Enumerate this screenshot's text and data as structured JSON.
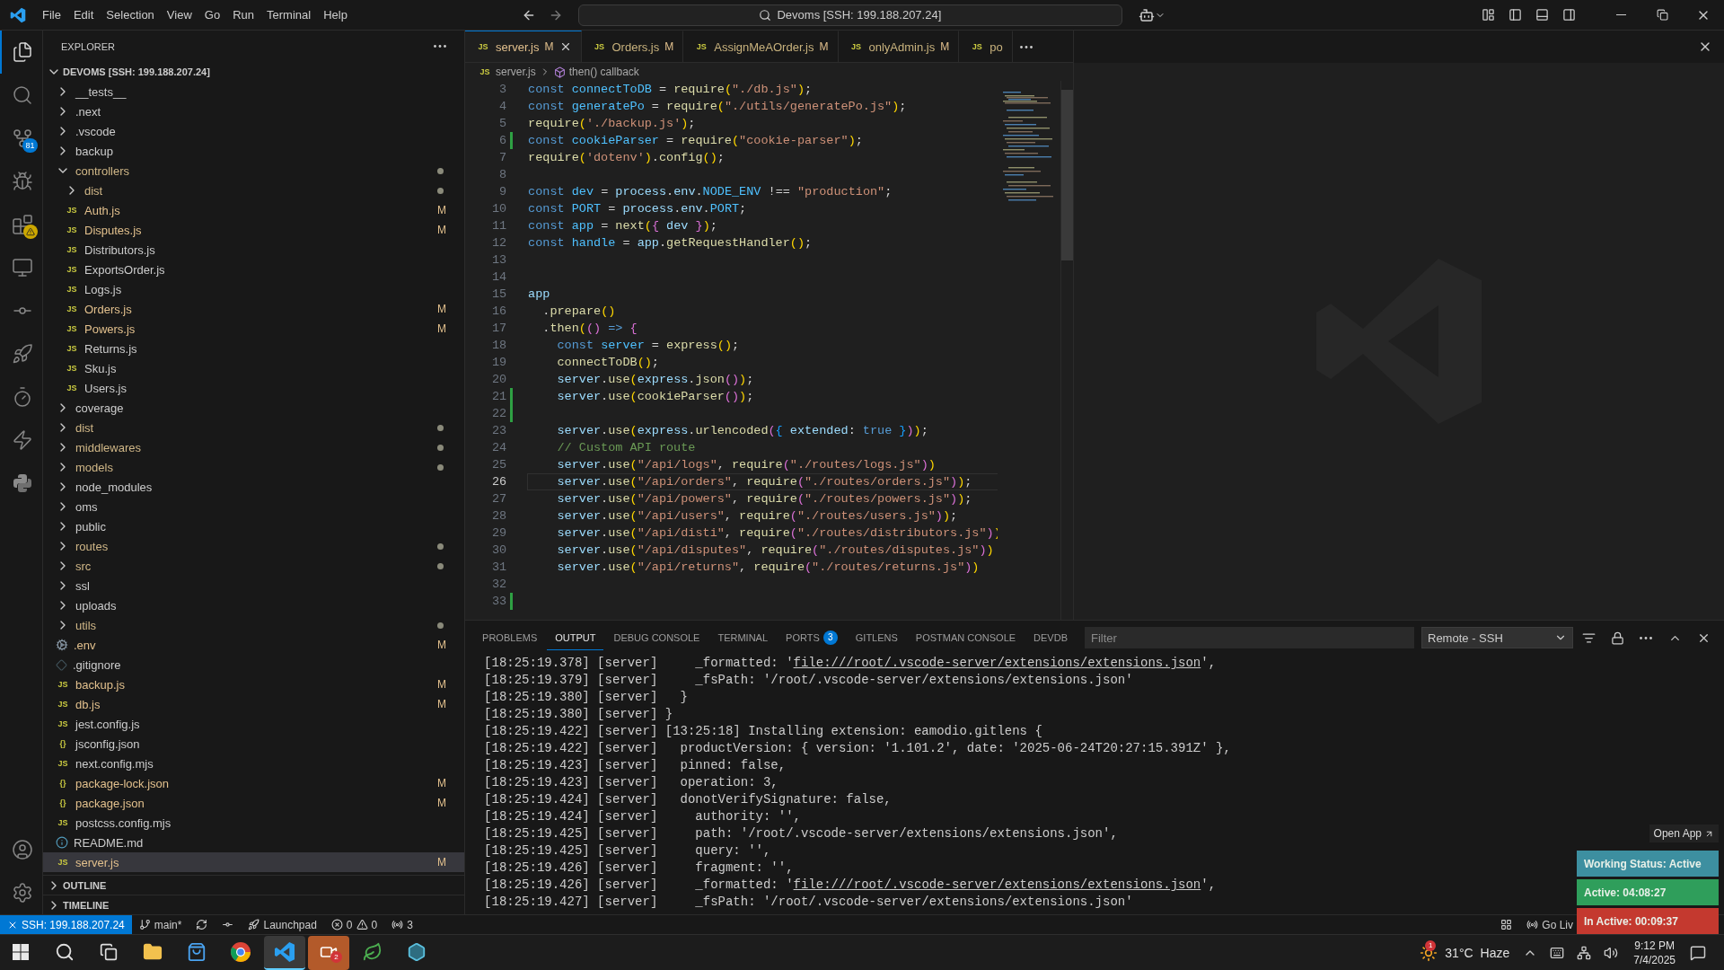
{
  "titlebar": {
    "menus": [
      "File",
      "Edit",
      "Selection",
      "View",
      "Go",
      "Run",
      "Terminal",
      "Help"
    ],
    "command_center": "Devoms [SSH: 199.188.207.24]"
  },
  "activity": [
    {
      "kind": "explorer",
      "selected": true,
      "warning": false
    },
    {
      "kind": "search",
      "selected": false,
      "warning": false
    },
    {
      "kind": "scm",
      "selected": false,
      "warning": false,
      "badge": "81"
    },
    {
      "kind": "debug",
      "selected": false,
      "warning": false
    },
    {
      "kind": "extensions",
      "selected": false,
      "warning": true
    },
    {
      "kind": "remote",
      "selected": false,
      "warning": false
    },
    {
      "kind": "gitlens",
      "selected": false,
      "warning": false
    },
    {
      "kind": "deploy",
      "selected": false,
      "warning": false
    },
    {
      "kind": "devdb",
      "selected": false,
      "warning": false
    },
    {
      "kind": "bolt",
      "selected": false,
      "warning": false
    },
    {
      "kind": "python",
      "selected": false,
      "warning": false
    }
  ],
  "sidebar": {
    "title": "EXPLORER",
    "root": {
      "label": "DEVOMS [SSH: 199.188.207.24]",
      "expanded": true
    },
    "items": [
      {
        "kind": "folder",
        "name": "__tests__",
        "expanded": false,
        "selected": false,
        "changes": false
      },
      {
        "kind": "folder",
        "name": ".next",
        "expanded": false,
        "selected": false,
        "changes": false
      },
      {
        "kind": "folder",
        "name": ".vscode",
        "expanded": false,
        "selected": false,
        "changes": false
      },
      {
        "kind": "folder",
        "name": "backup",
        "expanded": false,
        "selected": false,
        "changes": false
      },
      {
        "kind": "folder",
        "name": "controllers",
        "expanded": true,
        "selected": false,
        "changes": true,
        "children": [
          {
            "kind": "folder",
            "name": "dist",
            "expanded": false,
            "selected": false,
            "changes": true
          },
          {
            "kind": "file",
            "name": "Auth.js",
            "glyph": "JS",
            "selected": false,
            "status": "M"
          },
          {
            "kind": "file",
            "name": "Disputes.js",
            "glyph": "JS",
            "selected": false,
            "status": "M"
          },
          {
            "kind": "file",
            "name": "Distributors.js",
            "glyph": "JS",
            "selected": false
          },
          {
            "kind": "file",
            "name": "ExportsOrder.js",
            "glyph": "JS",
            "selected": false
          },
          {
            "kind": "file",
            "name": "Logs.js",
            "glyph": "JS",
            "selected": false
          },
          {
            "kind": "file",
            "name": "Orders.js",
            "glyph": "JS",
            "selected": false,
            "status": "M"
          },
          {
            "kind": "file",
            "name": "Powers.js",
            "glyph": "JS",
            "selected": false,
            "status": "M"
          },
          {
            "kind": "file",
            "name": "Returns.js",
            "glyph": "JS",
            "selected": false
          },
          {
            "kind": "file",
            "name": "Sku.js",
            "glyph": "JS",
            "selected": false
          },
          {
            "kind": "file",
            "name": "Users.js",
            "glyph": "JS",
            "selected": false
          }
        ]
      },
      {
        "kind": "folder",
        "name": "coverage",
        "expanded": false,
        "selected": false,
        "changes": false
      },
      {
        "kind": "folder",
        "name": "dist",
        "expanded": false,
        "selected": false,
        "changes": true
      },
      {
        "kind": "folder",
        "name": "middlewares",
        "expanded": false,
        "selected": false,
        "changes": true
      },
      {
        "kind": "folder",
        "name": "models",
        "expanded": false,
        "selected": false,
        "changes": true
      },
      {
        "kind": "folder",
        "name": "node_modules",
        "expanded": false,
        "selected": false,
        "changes": false
      },
      {
        "kind": "folder",
        "name": "oms",
        "expanded": false,
        "selected": false,
        "changes": false
      },
      {
        "kind": "folder",
        "name": "public",
        "expanded": false,
        "selected": false,
        "changes": false
      },
      {
        "kind": "folder",
        "name": "routes",
        "expanded": false,
        "selected": false,
        "changes": true
      },
      {
        "kind": "folder",
        "name": "src",
        "expanded": false,
        "selected": false,
        "changes": true
      },
      {
        "kind": "folder",
        "name": "ssl",
        "expanded": false,
        "selected": false,
        "changes": false
      },
      {
        "kind": "folder",
        "name": "uploads",
        "expanded": false,
        "selected": false,
        "changes": false
      },
      {
        "kind": "folder",
        "name": "utils",
        "expanded": false,
        "selected": false,
        "changes": true
      },
      {
        "kind": "config",
        "name": ".env",
        "selected": false,
        "status": "M"
      },
      {
        "kind": "ignore",
        "name": ".gitignore",
        "selected": false
      },
      {
        "kind": "file",
        "name": "backup.js",
        "glyph": "JS",
        "selected": false,
        "status": "M"
      },
      {
        "kind": "file",
        "name": "db.js",
        "glyph": "JS",
        "selected": false,
        "status": "M"
      },
      {
        "kind": "file",
        "name": "jest.config.js",
        "glyph": "JS",
        "selected": false
      },
      {
        "kind": "file",
        "name": "jsconfig.json",
        "glyph": "{}",
        "selected": false
      },
      {
        "kind": "file",
        "name": "next.config.mjs",
        "glyph": "JS",
        "selected": false
      },
      {
        "kind": "file",
        "name": "package-lock.json",
        "glyph": "{}",
        "selected": false,
        "status": "M"
      },
      {
        "kind": "file",
        "name": "package.json",
        "glyph": "{}",
        "selected": false,
        "status": "M"
      },
      {
        "kind": "file",
        "name": "postcss.config.mjs",
        "glyph": "JS",
        "selected": false
      },
      {
        "kind": "readme",
        "name": "README.md",
        "selected": false
      },
      {
        "kind": "file",
        "name": "server.js",
        "glyph": "JS",
        "selected": true,
        "status": "M"
      }
    ],
    "sections": [
      {
        "label": "OUTLINE",
        "expanded": false
      },
      {
        "label": "TIMELINE",
        "expanded": false
      }
    ]
  },
  "tabs": [
    {
      "glyph": "JS",
      "label": "server.js",
      "status": "M",
      "selected": true
    },
    {
      "glyph": "JS",
      "label": "Orders.js",
      "status": "M",
      "selected": false
    },
    {
      "glyph": "JS",
      "label": "AssignMeAOrder.js",
      "status": "M",
      "selected": false
    },
    {
      "glyph": "JS",
      "label": "onlyAdmin.js",
      "status": "M",
      "selected": false
    },
    {
      "glyph": "JS",
      "label": "po",
      "selected": false
    }
  ],
  "breadcrumb": {
    "file_glyph": "JS",
    "file": "server.js",
    "symbol": "then() callback"
  },
  "code": [
    {
      "n": "3",
      "changed": false,
      "current": false,
      "text": "const connectToDB = require(\"./db.js\");"
    },
    {
      "n": "4",
      "changed": false,
      "current": false,
      "text": "const generatePo = require(\"./utils/generatePo.js\");"
    },
    {
      "n": "5",
      "changed": false,
      "current": false,
      "text": "require('./backup.js');"
    },
    {
      "n": "6",
      "changed": true,
      "current": false,
      "text": "const cookieParser = require(\"cookie-parser\");"
    },
    {
      "n": "7",
      "changed": false,
      "current": false,
      "text": "require('dotenv').config();"
    },
    {
      "n": "8",
      "changed": false,
      "current": false
    },
    {
      "n": "9",
      "changed": false,
      "current": false,
      "text": "const dev = process.env.NODE_ENV !== \"production\";"
    },
    {
      "n": "10",
      "changed": false,
      "current": false,
      "text": "const PORT = process.env.PORT;"
    },
    {
      "n": "11",
      "changed": false,
      "current": false,
      "text": "const app = next({ dev });"
    },
    {
      "n": "12",
      "changed": false,
      "current": false,
      "text": "const handle = app.getRequestHandler();"
    },
    {
      "n": "13",
      "changed": false,
      "current": false
    },
    {
      "n": "14",
      "changed": false,
      "current": false
    },
    {
      "n": "15",
      "changed": false,
      "current": false,
      "text": "app"
    },
    {
      "n": "16",
      "changed": false,
      "current": false,
      "text": "  .prepare()"
    },
    {
      "n": "17",
      "changed": false,
      "current": false,
      "text": "  .then(() => {"
    },
    {
      "n": "18",
      "changed": false,
      "current": false,
      "text": "    const server = express();"
    },
    {
      "n": "19",
      "changed": false,
      "current": false,
      "text": "    connectToDB();"
    },
    {
      "n": "20",
      "changed": false,
      "current": false,
      "text": "    server.use(express.json());"
    },
    {
      "n": "21",
      "changed": true,
      "current": false,
      "text": "    server.use(cookieParser());"
    },
    {
      "n": "22",
      "changed": true,
      "current": false
    },
    {
      "n": "23",
      "changed": false,
      "current": false,
      "text": "    server.use(express.urlencoded({ extended: true }));"
    },
    {
      "n": "24",
      "changed": false,
      "current": false,
      "text": "    // Custom API route"
    },
    {
      "n": "25",
      "changed": false,
      "current": false,
      "text": "    server.use(\"/api/logs\", require(\"./routes/logs.js\"))"
    },
    {
      "n": "26",
      "changed": false,
      "current": true,
      "text": "    server.use(\"/api/orders\", require(\"./routes/orders.js\"));"
    },
    {
      "n": "27",
      "changed": false,
      "current": false,
      "text": "    server.use(\"/api/powers\", require(\"./routes/powers.js\"));"
    },
    {
      "n": "28",
      "changed": false,
      "current": false,
      "text": "    server.use(\"/api/users\", require(\"./routes/users.js\"));"
    },
    {
      "n": "29",
      "changed": false,
      "current": false,
      "text": "    server.use(\"/api/disti\", require(\"./routes/distributors.js\"))"
    },
    {
      "n": "30",
      "changed": false,
      "current": false,
      "text": "    server.use(\"/api/disputes\", require(\"./routes/disputes.js\"))"
    },
    {
      "n": "31",
      "changed": false,
      "current": false,
      "text": "    server.use(\"/api/returns\", require(\"./routes/returns.js\"))"
    },
    {
      "n": "32",
      "changed": false,
      "current": false
    },
    {
      "n": "33",
      "changed": true,
      "current": false
    }
  ],
  "panel": {
    "tabs": [
      {
        "label": "PROBLEMS",
        "selected": false
      },
      {
        "label": "OUTPUT",
        "selected": true
      },
      {
        "label": "DEBUG CONSOLE",
        "selected": false
      },
      {
        "label": "TERMINAL",
        "selected": false
      },
      {
        "label": "PORTS",
        "badge": "3",
        "selected": false
      },
      {
        "label": "GITLENS",
        "selected": false
      },
      {
        "label": "POSTMAN CONSOLE",
        "selected": false
      },
      {
        "label": "DEVDB",
        "selected": false
      }
    ],
    "filter": {
      "placeholder": "Filter"
    },
    "channel": "Remote - SSH",
    "lines": [
      [
        {
          "kind": "text",
          "text": "[18:25:19.378] [server]     _formatted: '"
        },
        {
          "kind": "link",
          "text": "file:///root/.vscode-server/extensions/extensions.json"
        },
        {
          "kind": "text",
          "text": "',"
        }
      ],
      [
        {
          "kind": "text",
          "text": "[18:25:19.379] [server]     _fsPath: '/root/.vscode-server/extensions/extensions.json'"
        }
      ],
      [
        {
          "kind": "text",
          "text": "[18:25:19.380] [server]   }"
        }
      ],
      [
        {
          "kind": "text",
          "text": "[18:25:19.380] [server] }"
        }
      ],
      [
        {
          "kind": "text",
          "text": "[18:25:19.422] [server] [13:25:18] Installing extension: eamodio.gitlens {"
        }
      ],
      [
        {
          "kind": "text",
          "text": "[18:25:19.422] [server]   productVersion: { version: '1.101.2', date: '2025-06-24T20:27:15.391Z' },"
        }
      ],
      [
        {
          "kind": "text",
          "text": "[18:25:19.423] [server]   pinned: false,"
        }
      ],
      [
        {
          "kind": "text",
          "text": "[18:25:19.423] [server]   operation: 3,"
        }
      ],
      [
        {
          "kind": "text",
          "text": "[18:25:19.424] [server]   donotVerifySignature: false,"
        }
      ],
      [
        {
          "kind": "text",
          "text": "[18:25:19.424] [server]     authority: '',"
        }
      ],
      [
        {
          "kind": "text",
          "text": "[18:25:19.425] [server]     path: '/root/.vscode-server/extensions/extensions.json',"
        }
      ],
      [
        {
          "kind": "text",
          "text": "[18:25:19.425] [server]     query: '',"
        }
      ],
      [
        {
          "kind": "text",
          "text": "[18:25:19.426] [server]     fragment: '',"
        }
      ],
      [
        {
          "kind": "text",
          "text": "[18:25:19.426] [server]     _formatted: '"
        },
        {
          "kind": "link",
          "text": "file:///root/.vscode-server/extensions/extensions.json"
        },
        {
          "kind": "text",
          "text": "',"
        }
      ],
      [
        {
          "kind": "text",
          "text": "[18:25:19.427] [server]     _fsPath: '/root/.vscode-server/extensions/extensions.json'"
        }
      ]
    ]
  },
  "tracker": {
    "open_app": "Open App",
    "statuses": [
      {
        "text": "Working Status: Active",
        "color": "#3d8fa0"
      },
      {
        "text": "Active: 04:08:27",
        "color": "#2f9e5b"
      },
      {
        "text": "In Active: 00:09:37",
        "color": "#c4392f"
      }
    ]
  },
  "statusbar": {
    "left": [
      {
        "kind": "remote",
        "text": "SSH: 199.188.207.24"
      },
      {
        "kind": "branch",
        "text": "main*"
      },
      {
        "kind": "sync"
      },
      {
        "kind": "graph"
      },
      {
        "kind": "launchpad",
        "text": "Launchpad"
      },
      {
        "kind": "problems",
        "errors": "0",
        "warnings": "0"
      },
      {
        "kind": "ports",
        "text": "3"
      }
    ],
    "right": [
      {
        "kind": "layout"
      },
      {
        "kind": "golive",
        "text": "Go Liv"
      }
    ]
  },
  "taskbar": {
    "apps": [
      {
        "kind": "start",
        "selected": false
      },
      {
        "kind": "search",
        "selected": false
      },
      {
        "kind": "taskview",
        "selected": false
      },
      {
        "kind": "files",
        "selected": false
      },
      {
        "kind": "store",
        "selected": false
      },
      {
        "kind": "browser",
        "selected": false
      },
      {
        "kind": "editor",
        "selected": true
      },
      {
        "kind": "meeting",
        "selected": false,
        "badge": "2"
      },
      {
        "kind": "leaf",
        "selected": false
      },
      {
        "kind": "hex",
        "selected": false
      }
    ],
    "weather": {
      "badge": "1",
      "temp": "31°C",
      "condition": "Haze"
    },
    "time": "9:12 PM",
    "date": "7/4/2025"
  }
}
